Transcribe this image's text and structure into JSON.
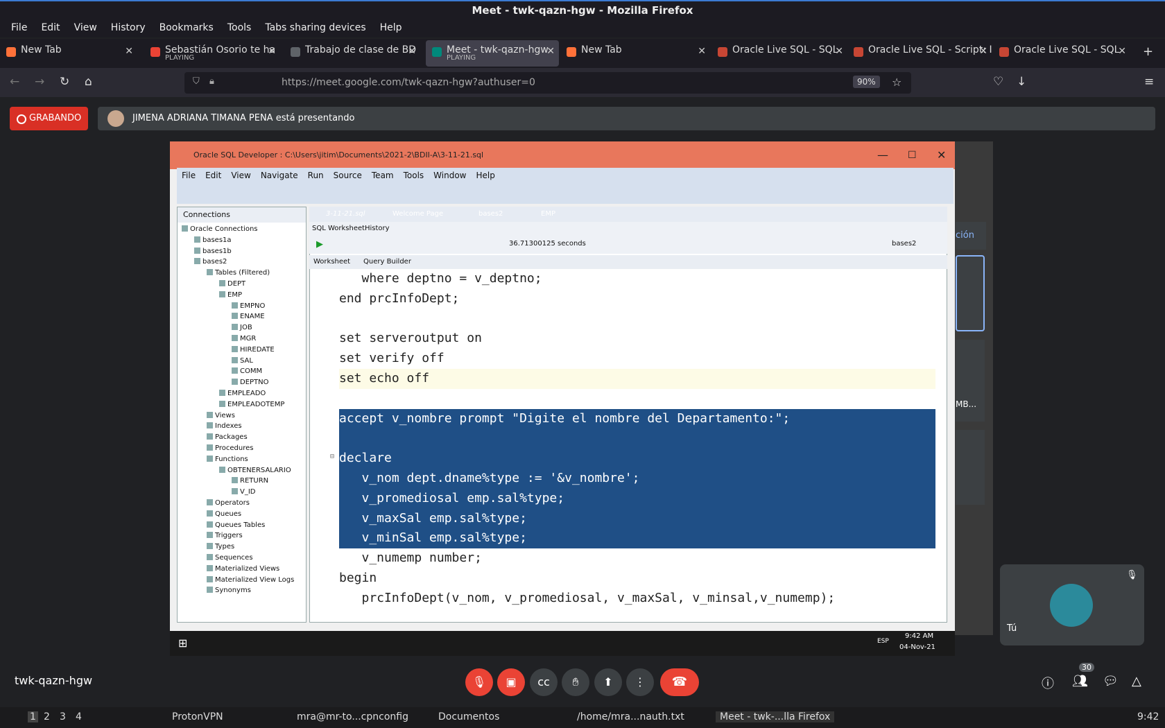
{
  "browser": {
    "title": "Meet - twk-qazn-hgw - Mozilla Firefox",
    "menu": [
      "File",
      "Edit",
      "View",
      "History",
      "Bookmarks",
      "Tools",
      "Tabs sharing devices",
      "Help"
    ],
    "tabs": [
      {
        "label": "New Tab",
        "sub": ""
      },
      {
        "label": "Sebastián Osorio te ha",
        "sub": "PLAYING"
      },
      {
        "label": "Trabajo de clase de BD",
        "sub": ""
      },
      {
        "label": "Meet - twk-qazn-hgw",
        "sub": "PLAYING"
      },
      {
        "label": "New Tab",
        "sub": ""
      },
      {
        "label": "Oracle Live SQL - SQL",
        "sub": ""
      },
      {
        "label": "Oracle Live SQL - Script: I",
        "sub": ""
      },
      {
        "label": "Oracle Live SQL - SQL",
        "sub": ""
      }
    ],
    "url": "https://meet.google.com/twk-qazn-hgw?authuser=0",
    "zoom": "90%"
  },
  "meet": {
    "recording": "GRABANDO",
    "presenting": "JIMENA ADRIANA TIMANA PENA está presentando",
    "meeting_code": "twk-qazn-hgw",
    "self_label": "Tú",
    "participants_count": "30",
    "side_partial": "ción",
    "side_partial2": "MB..."
  },
  "sqldev": {
    "title": "Oracle SQL Developer : C:\\Users\\jitim\\Documents\\2021-2\\BDII-A\\3-11-21.sql",
    "menu": [
      "File",
      "Edit",
      "View",
      "Navigate",
      "Run",
      "Source",
      "Team",
      "Tools",
      "Window",
      "Help"
    ],
    "connections_title": "Connections",
    "tree": [
      {
        "t": "Oracle Connections",
        "lvl": 0
      },
      {
        "t": "bases1a",
        "lvl": 1
      },
      {
        "t": "bases1b",
        "lvl": 1
      },
      {
        "t": "bases2",
        "lvl": 1
      },
      {
        "t": "Tables (Filtered)",
        "lvl": 2
      },
      {
        "t": "DEPT",
        "lvl": 3
      },
      {
        "t": "EMP",
        "lvl": 3
      },
      {
        "t": "EMPNO",
        "lvl": 4
      },
      {
        "t": "ENAME",
        "lvl": 4
      },
      {
        "t": "JOB",
        "lvl": 4
      },
      {
        "t": "MGR",
        "lvl": 4
      },
      {
        "t": "HIREDATE",
        "lvl": 4
      },
      {
        "t": "SAL",
        "lvl": 4
      },
      {
        "t": "COMM",
        "lvl": 4
      },
      {
        "t": "DEPTNO",
        "lvl": 4
      },
      {
        "t": "EMPLEADO",
        "lvl": 3
      },
      {
        "t": "EMPLEADOTEMP",
        "lvl": 3
      },
      {
        "t": "Views",
        "lvl": 2
      },
      {
        "t": "Indexes",
        "lvl": 2
      },
      {
        "t": "Packages",
        "lvl": 2
      },
      {
        "t": "Procedures",
        "lvl": 2
      },
      {
        "t": "Functions",
        "lvl": 2
      },
      {
        "t": "OBTENERSALARIO",
        "lvl": 3
      },
      {
        "t": "RETURN",
        "lvl": 4
      },
      {
        "t": "V_ID",
        "lvl": 4
      },
      {
        "t": "Operators",
        "lvl": 2
      },
      {
        "t": "Queues",
        "lvl": 2
      },
      {
        "t": "Queues Tables",
        "lvl": 2
      },
      {
        "t": "Triggers",
        "lvl": 2
      },
      {
        "t": "Types",
        "lvl": 2
      },
      {
        "t": "Sequences",
        "lvl": 2
      },
      {
        "t": "Materialized Views",
        "lvl": 2
      },
      {
        "t": "Materialized View Logs",
        "lvl": 2
      },
      {
        "t": "Synonyms",
        "lvl": 2
      }
    ],
    "doc_tabs": [
      "3-11-21.sql",
      "Welcome Page",
      "bases2",
      "EMP"
    ],
    "ws_tabs": [
      "SQL Worksheet",
      "History"
    ],
    "timing": "36.71300125 seconds",
    "connection": "bases2",
    "sub_tabs": [
      "Worksheet",
      "Query Builder"
    ],
    "code": [
      "   where deptno = v_deptno;",
      "end prcInfoDept;",
      "",
      "set serveroutput on",
      "set verify off",
      "set echo off",
      "",
      "accept v_nombre prompt \"Digite el nombre del Departamento:\";",
      "",
      "declare",
      "   v_nom dept.dname%type := '&v_nombre';",
      "   v_promediosal emp.sal%type;",
      "   v_maxSal emp.sal%type;",
      "   v_minSal emp.sal%type;",
      "   v_numemp number;",
      "begin",
      "   prcInfoDept(v_nom, v_promediosal, v_maxSal, v_minsal,v_numemp);"
    ],
    "win_taskbar": {
      "time": "9:42 AM",
      "date": "04-Nov-21",
      "lang": "ESP"
    }
  },
  "os_taskbar": {
    "workspaces": [
      "1",
      "2",
      "3",
      "4"
    ],
    "items": [
      "ProtonVPN",
      "mra@mr-to...cpnconfig",
      "Documentos",
      "/home/mra...nauth.txt",
      "Meet - twk-...lla Firefox"
    ],
    "clock": "9:42"
  }
}
